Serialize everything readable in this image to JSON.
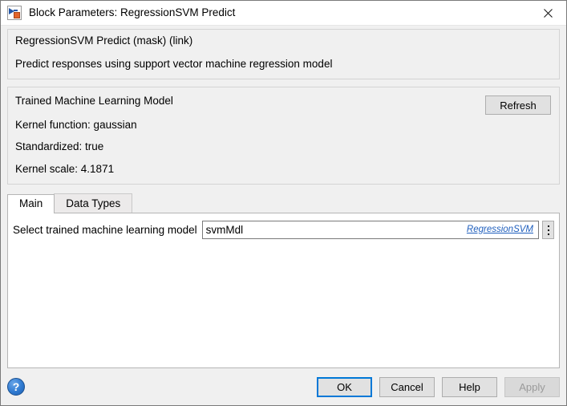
{
  "window": {
    "title": "Block Parameters: RegressionSVM Predict",
    "icon": "simulink-block-icon",
    "close_icon": "close-icon"
  },
  "description": {
    "header": "RegressionSVM Predict (mask) (link)",
    "text": "Predict responses using support vector machine regression model"
  },
  "model_section": {
    "heading": "Trained Machine Learning Model",
    "properties": [
      "Kernel function: gaussian",
      "Standardized: true",
      "Kernel scale: 4.1871"
    ],
    "refresh_label": "Refresh"
  },
  "tabs": [
    {
      "label": "Main",
      "active": true
    },
    {
      "label": "Data Types",
      "active": false
    }
  ],
  "main_tab": {
    "model_label": "Select trained machine learning model",
    "model_value": "svmMdl",
    "model_placeholder": "",
    "model_type_link": "RegressionSVM",
    "menu_icon": "vertical-ellipsis-icon"
  },
  "footer": {
    "help_icon": "help-question-icon",
    "help_glyph": "?",
    "buttons": [
      {
        "label": "OK",
        "state": "default"
      },
      {
        "label": "Cancel",
        "state": "normal"
      },
      {
        "label": "Help",
        "state": "normal"
      },
      {
        "label": "Apply",
        "state": "disabled"
      }
    ]
  },
  "colors": {
    "accent": "#0078d7",
    "link": "#1f5fbd",
    "dialog_bg": "#f0f0f0",
    "panel_bg": "#ffffff"
  }
}
